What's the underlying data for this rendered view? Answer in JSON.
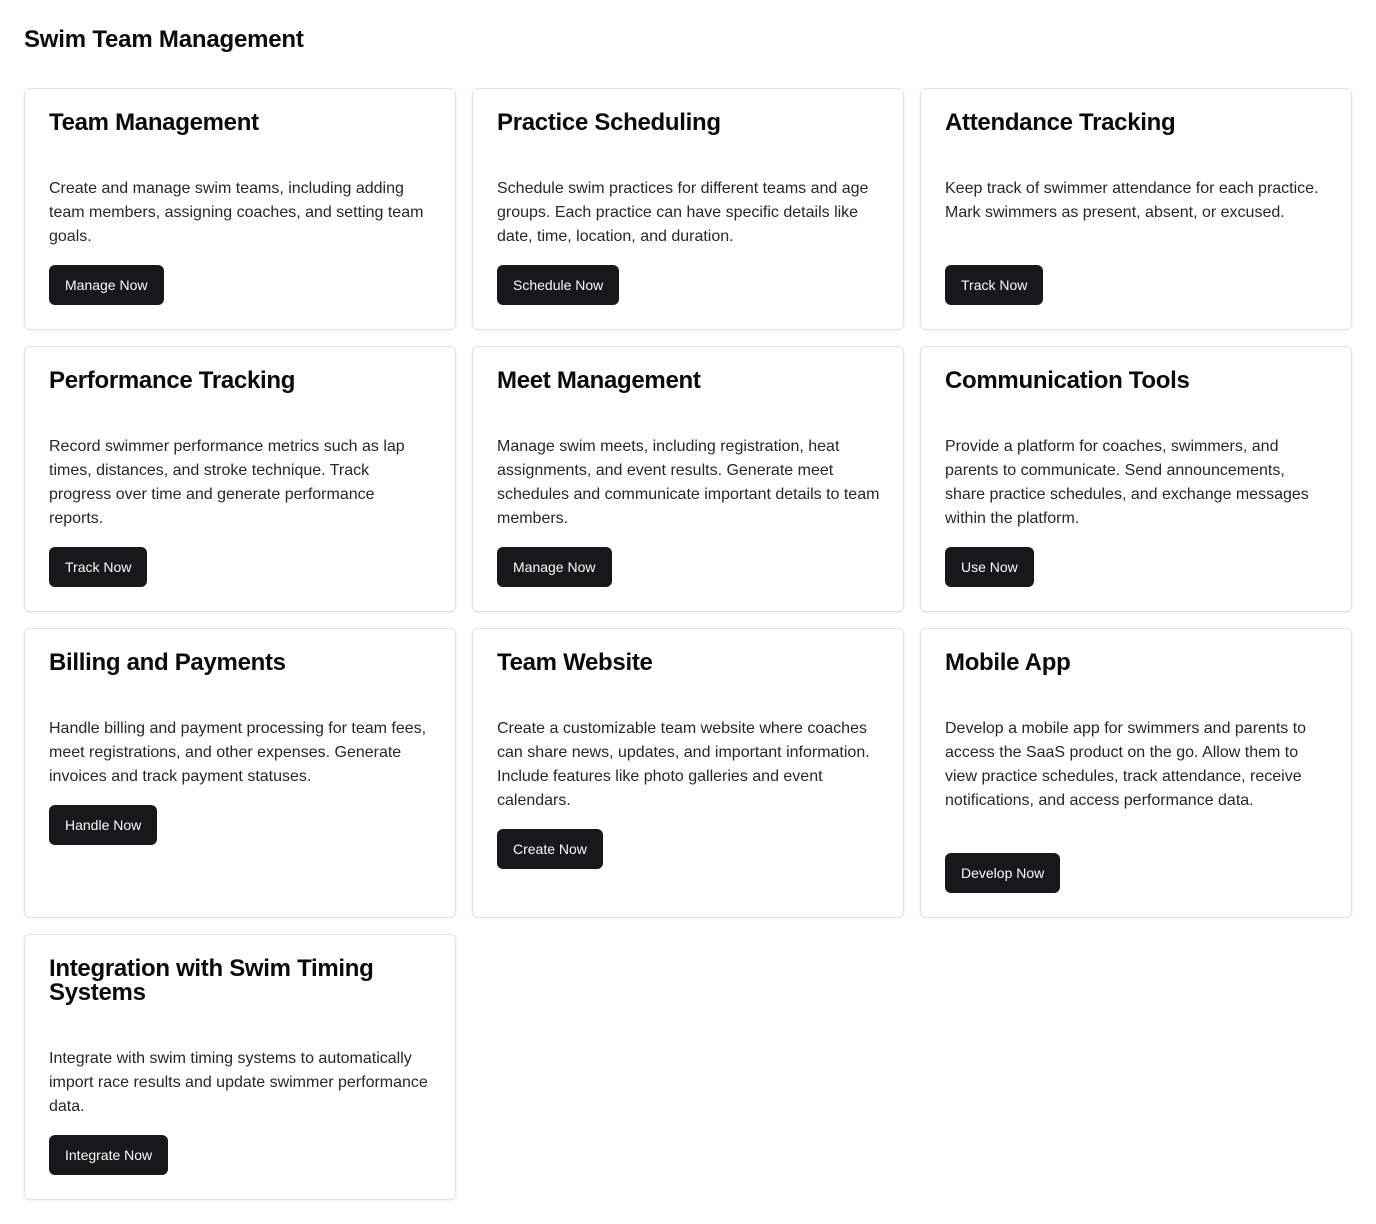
{
  "page": {
    "title": "Swim Team Management"
  },
  "cards": [
    {
      "title": "Team Management",
      "description": "Create and manage swim teams, including adding team members, assigning coaches, and setting team goals.",
      "button": "Manage Now"
    },
    {
      "title": "Practice Scheduling",
      "description": "Schedule swim practices for different teams and age groups. Each practice can have specific details like date, time, location, and duration.",
      "button": "Schedule Now"
    },
    {
      "title": "Attendance Tracking",
      "description": "Keep track of swimmer attendance for each practice. Mark swimmers as present, absent, or excused.",
      "button": "Track Now"
    },
    {
      "title": "Performance Tracking",
      "description": "Record swimmer performance metrics such as lap times, distances, and stroke technique. Track progress over time and generate performance reports.",
      "button": "Track Now"
    },
    {
      "title": "Meet Management",
      "description": "Manage swim meets, including registration, heat assignments, and event results. Generate meet schedules and communicate important details to team members.",
      "button": "Manage Now"
    },
    {
      "title": "Communication Tools",
      "description": "Provide a platform for coaches, swimmers, and parents to communicate. Send announcements, share practice schedules, and exchange messages within the platform.",
      "button": "Use Now"
    },
    {
      "title": "Billing and Payments",
      "description": "Handle billing and payment processing for team fees, meet registrations, and other expenses. Generate invoices and track payment statuses.",
      "button": "Handle Now"
    },
    {
      "title": "Team Website",
      "description": "Create a customizable team website where coaches can share news, updates, and important information. Include features like photo galleries and event calendars.",
      "button": "Create Now"
    },
    {
      "title": "Mobile App",
      "description": "Develop a mobile app for swimmers and parents to access the SaaS product on the go. Allow them to view practice schedules, track attendance, receive notifications, and access performance data.",
      "button": "Develop Now"
    },
    {
      "title": "Integration with Swim Timing Systems",
      "description": "Integrate with swim timing systems to automatically import race results and update swimmer performance data.",
      "button": "Integrate Now"
    }
  ],
  "colors": {
    "button_bg": "#18181b",
    "button_text": "#fafafa",
    "card_border": "#e4e4e7",
    "text": "#0a0a0a"
  }
}
